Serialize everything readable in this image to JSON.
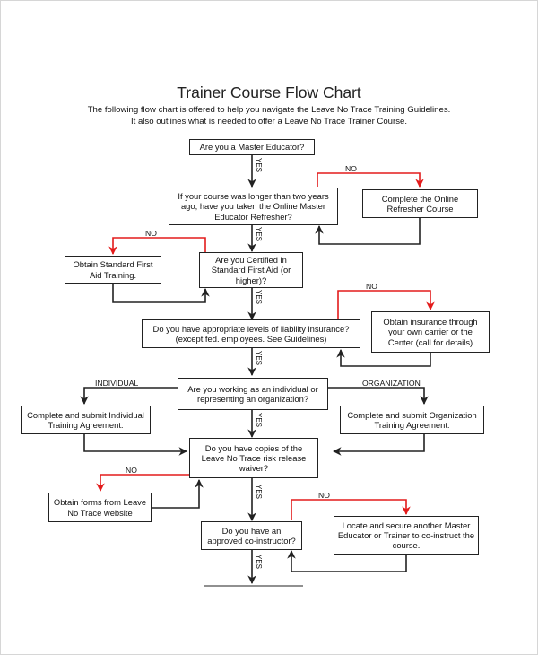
{
  "header": {
    "title": "Trainer Course Flow Chart",
    "subtitle_line1": "The following flow chart is offered to help you navigate the Leave No Trace Training Guidelines.",
    "subtitle_line2": "It also outlines what is needed to offer a Leave No Trace Trainer Course."
  },
  "colors": {
    "yes_path": "#222222",
    "no_path": "#e31b1b",
    "box_border": "#222222"
  },
  "nodes": {
    "q_master_educator": "Are you a Master Educator?",
    "q_refresher": "If your course was longer than two years ago, have you taken the Online Master Educator Refresher?",
    "a_refresher": "Complete the Online Refresher Course",
    "q_first_aid": "Are you Certified in Standard First Aid (or higher)?",
    "a_first_aid": "Obtain Standard First Aid Training.",
    "q_insurance": "Do you have appropriate levels of liability insurance? (except fed. employees. See Guidelines)",
    "a_insurance": "Obtain insurance through your own carrier or the Center (call for details)",
    "q_individual_org": "Are you working as an individual or representing an organization?",
    "a_individual": "Complete and submit Individual Training Agreement.",
    "a_organization": "Complete and submit Organization Training Agreement.",
    "q_waiver": "Do you have copies of the Leave No Trace risk release waiver?",
    "a_waiver": "Obtain forms from Leave No Trace website",
    "q_coinstructor": "Do you have an approved co-instructor?",
    "a_coinstructor": "Locate and secure another Master Educator or Trainer to co-instruct the course."
  },
  "edge_labels": {
    "yes": "YES",
    "no": "NO",
    "individual": "INDIVIDUAL",
    "organization": "ORGANIZATION"
  }
}
